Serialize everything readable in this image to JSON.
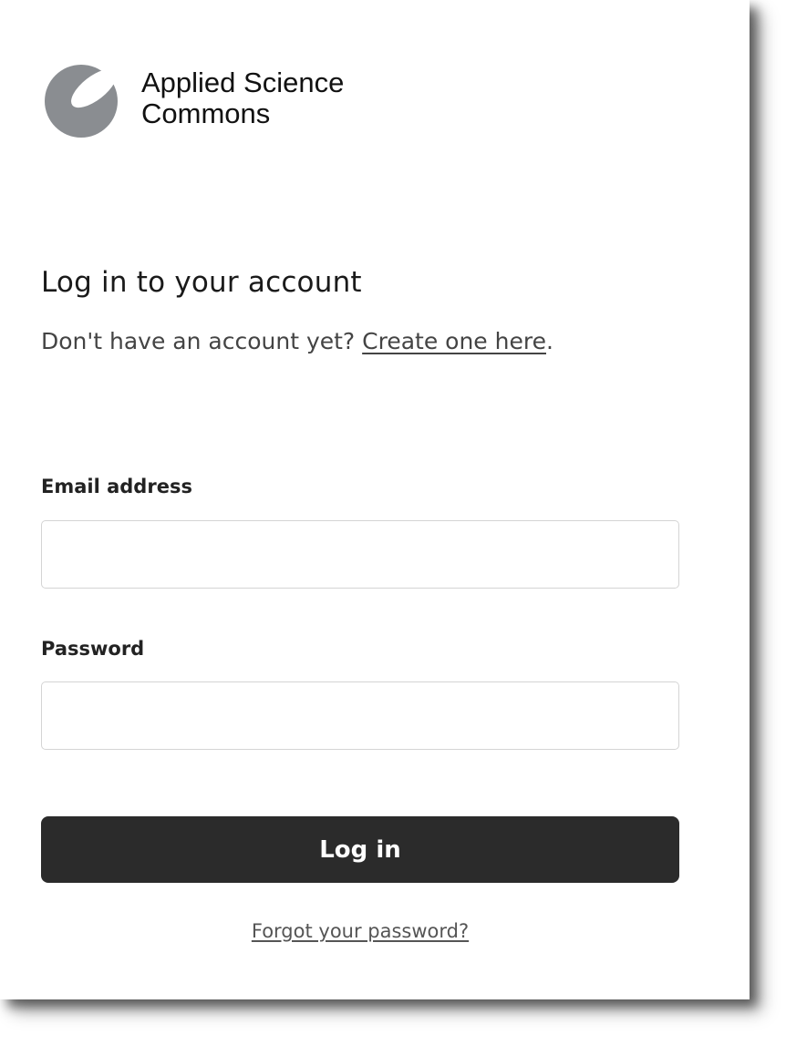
{
  "brand": {
    "logo_icon": "circle-logo-icon",
    "name_line1": "Applied Science",
    "name_line2": "Commons"
  },
  "login": {
    "title": "Log in to your account",
    "subtitle_prefix": "Don't have an account yet? ",
    "create_link": "Create one here",
    "subtitle_suffix": "."
  },
  "form": {
    "email_label": "Email address",
    "email_value": "",
    "password_label": "Password",
    "password_value": "",
    "submit_label": "Log in",
    "forgot_link": "Forgot your password?"
  },
  "colors": {
    "button_bg": "#2b2b2b",
    "logo_gray": "#8a8d91"
  }
}
